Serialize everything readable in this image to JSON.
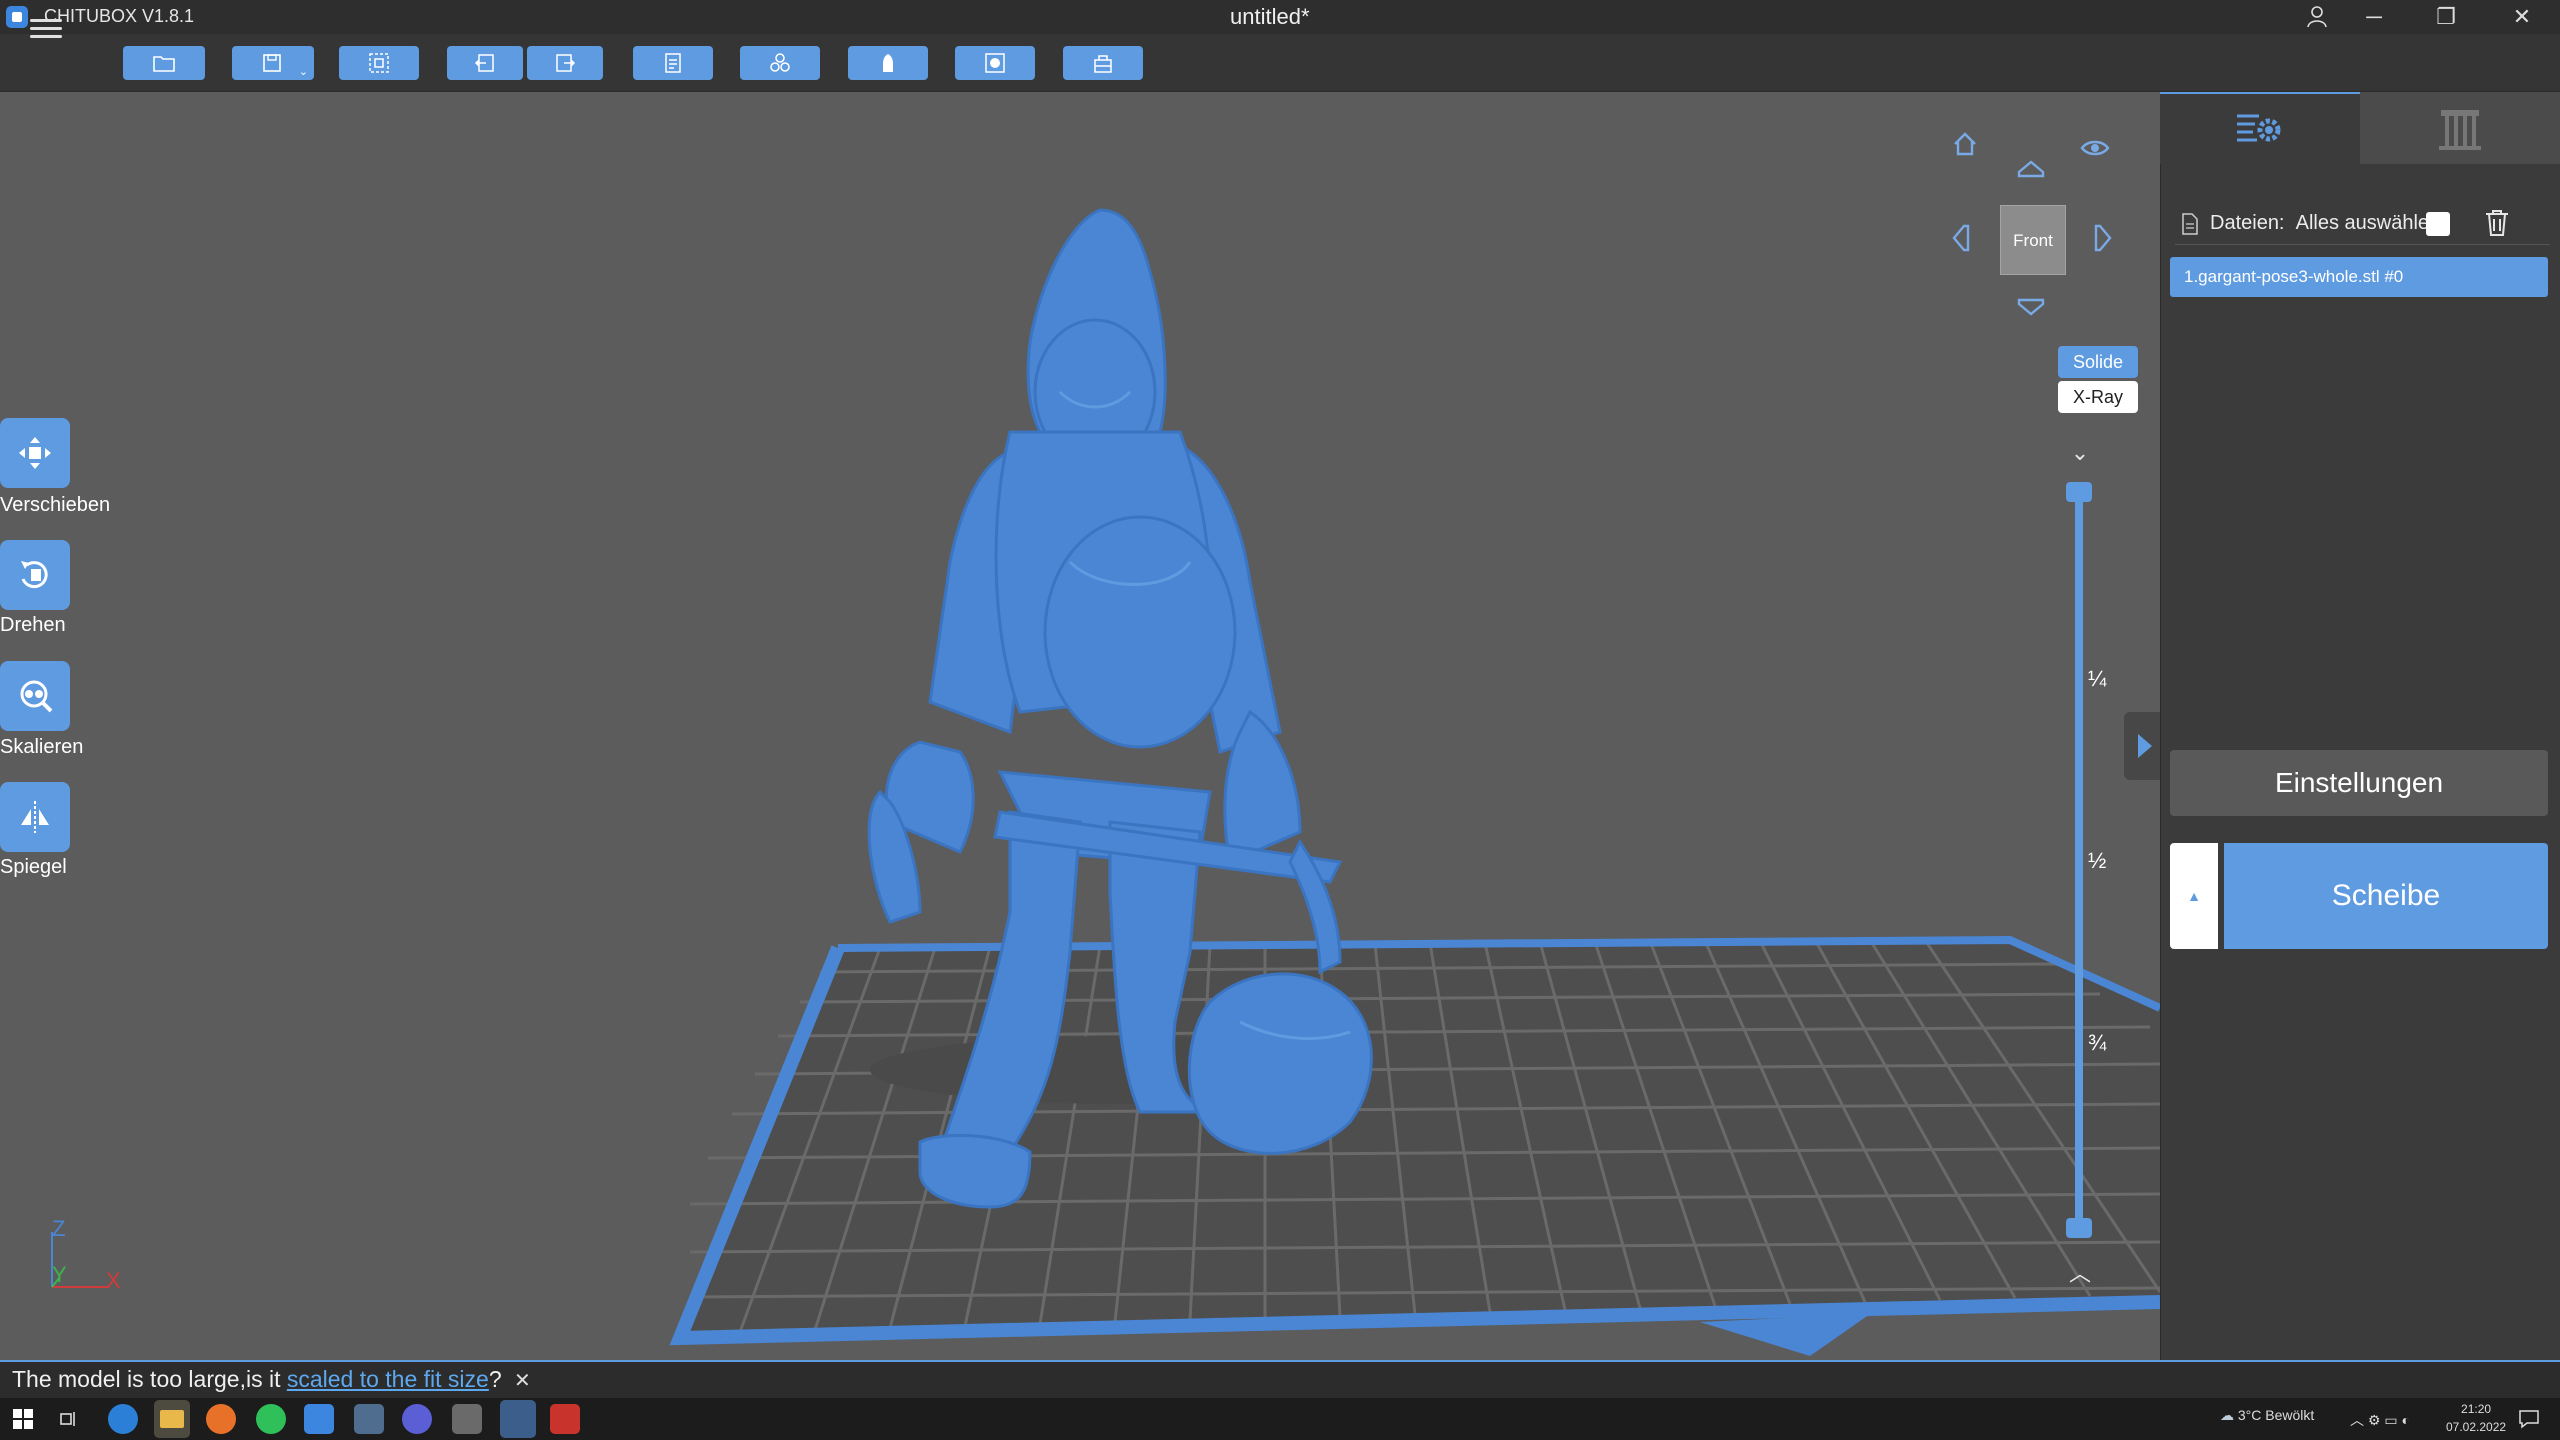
{
  "window": {
    "app_name": "CHITUBOX V1.8.1",
    "document_title": "untitled*",
    "controls": {
      "minimize": "─",
      "maximize": "❐",
      "close": "✕"
    }
  },
  "toolbar": {
    "buttons": [
      {
        "name": "open-file",
        "icon": "folder-icon"
      },
      {
        "name": "save",
        "icon": "save-icon"
      },
      {
        "name": "auto-layout",
        "icon": "layout-icon"
      },
      {
        "name": "undo",
        "icon": "undo-icon"
      },
      {
        "name": "redo",
        "icon": "redo-icon"
      },
      {
        "name": "print-settings",
        "icon": "document-icon"
      },
      {
        "name": "arrange",
        "icon": "arrange-icon"
      },
      {
        "name": "hollow",
        "icon": "hollow-icon"
      },
      {
        "name": "dig-hole",
        "icon": "hole-icon"
      },
      {
        "name": "base",
        "icon": "base-icon"
      }
    ]
  },
  "left_tools": [
    {
      "label": "Verschieben",
      "icon": "move-icon"
    },
    {
      "label": "Drehen",
      "icon": "rotate-icon"
    },
    {
      "label": "Skalieren",
      "icon": "scale-icon"
    },
    {
      "label": "Spiegel",
      "icon": "mirror-icon"
    }
  ],
  "view": {
    "cube_face": "Front",
    "modes": {
      "solid": "Solide",
      "xray": "X-Ray"
    },
    "active_mode": "Solide"
  },
  "layer_slider": {
    "ticks": [
      "¼",
      "½",
      "¾"
    ]
  },
  "axes": {
    "z": "Z",
    "y": "Y",
    "x": "X"
  },
  "panel": {
    "files_label": "Dateien:",
    "select_all_label": "Alles auswählen",
    "files": [
      "1.gargant-pose3-whole.stl #0"
    ],
    "settings_button": "Einstellungen",
    "slice_button": "Scheibe"
  },
  "message": {
    "prefix": "The model is too large,is it ",
    "link": "scaled to the fit size",
    "suffix": "?"
  },
  "taskbar": {
    "weather": "3°C  Bewölkt",
    "time": "21:20",
    "date": "07.02.2022"
  },
  "colors": {
    "accent": "#5e9be0",
    "model": "#4a86d4",
    "background": "#5c5c5c",
    "panel": "#3b3b3b"
  }
}
